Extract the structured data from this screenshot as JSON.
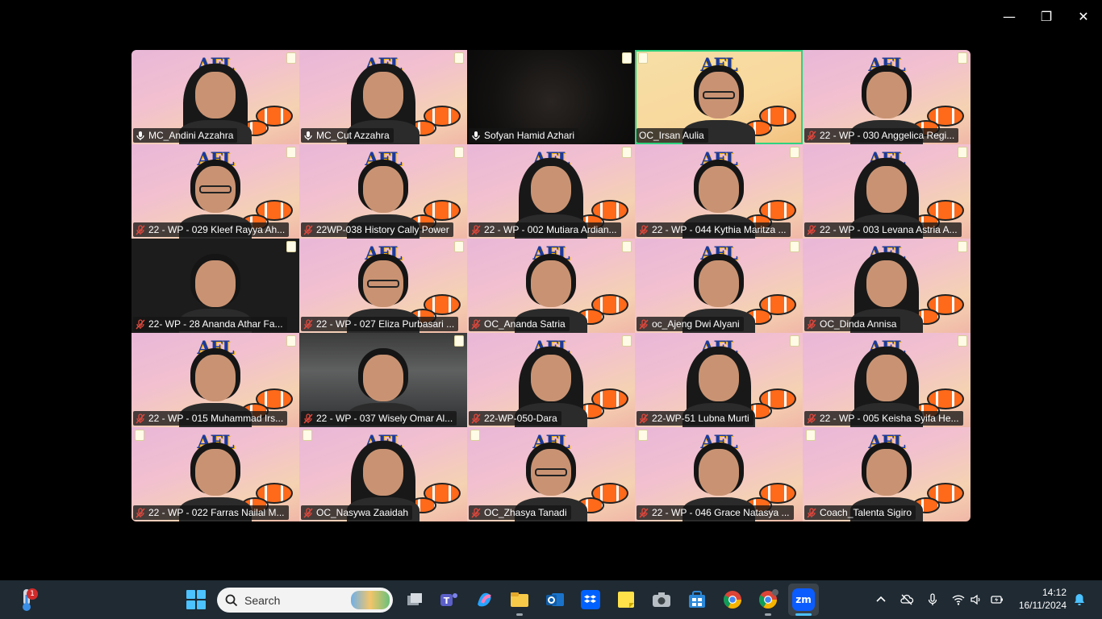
{
  "window": {
    "controls": {
      "minimize": "—",
      "restore": "❐",
      "close": "✕"
    }
  },
  "participants": [
    {
      "name": "MC_Andini Azzahra",
      "mic": "on"
    },
    {
      "name": "MC_Cut Azzahra",
      "mic": "on"
    },
    {
      "name": "Sofyan Hamid Azhari",
      "mic": "on"
    },
    {
      "name": "OC_Irsan Aulia",
      "mic": "none"
    },
    {
      "name": "22 - WP - 030 Anggelica Regi...",
      "mic": "muted"
    },
    {
      "name": "22 - WP - 029 Kleef Rayya Ah...",
      "mic": "muted"
    },
    {
      "name": "22WP-038 History Cally Power",
      "mic": "muted"
    },
    {
      "name": "22 - WP - 002 Mutiara Ardian...",
      "mic": "muted"
    },
    {
      "name": "22 - WP - 044 Kythia Maritza ...",
      "mic": "muted"
    },
    {
      "name": "22 - WP - 003 Levana Astria A...",
      "mic": "muted"
    },
    {
      "name": "22- WP - 28 Ananda Athar Fa...",
      "mic": "muted"
    },
    {
      "name": "22 - WP - 027 Eliza Purbasari ...",
      "mic": "muted"
    },
    {
      "name": "OC_Ananda Satria",
      "mic": "muted"
    },
    {
      "name": "oc_Ajeng Dwi Alyani",
      "mic": "muted"
    },
    {
      "name": "OC_Dinda Annisa",
      "mic": "muted"
    },
    {
      "name": "22 - WP - 015 Muhammad Irs...",
      "mic": "muted"
    },
    {
      "name": "22 - WP - 037 Wisely Omar Al...",
      "mic": "muted"
    },
    {
      "name": "22-WP-050-Dara",
      "mic": "muted"
    },
    {
      "name": "22-WP-51 Lubna Murti",
      "mic": "muted"
    },
    {
      "name": "22 - WP - 005 Keisha Syifa He...",
      "mic": "muted"
    },
    {
      "name": "22 - WP - 022 Farras Nailal M...",
      "mic": "muted"
    },
    {
      "name": "OC_Nasywa Zaaidah",
      "mic": "muted"
    },
    {
      "name": "OC_Zhasya Tanadi",
      "mic": "muted"
    },
    {
      "name": "22 - WP - 046 Grace Natasya ...",
      "mic": "muted"
    },
    {
      "name": "Coach_Talenta Sigiro",
      "mic": "muted"
    }
  ],
  "taskbar": {
    "weather_badge": "1",
    "search_label": "Search",
    "apps": [
      "file-explorer-icon",
      "task-view-icon",
      "teams-icon",
      "copilot-icon",
      "folder-icon",
      "outlook-icon",
      "dropbox-icon",
      "sticky-notes-icon",
      "camera-icon",
      "store-icon",
      "chrome-icon",
      "chrome-profile-icon",
      "zoom-icon"
    ],
    "zoom_label": "zm",
    "time": "14:12",
    "date": "16/11/2024"
  },
  "colors": {
    "active_speaker": "#2fd27f",
    "taskbar_bg": "#1f2a33",
    "mute_red": "#e0473c"
  }
}
